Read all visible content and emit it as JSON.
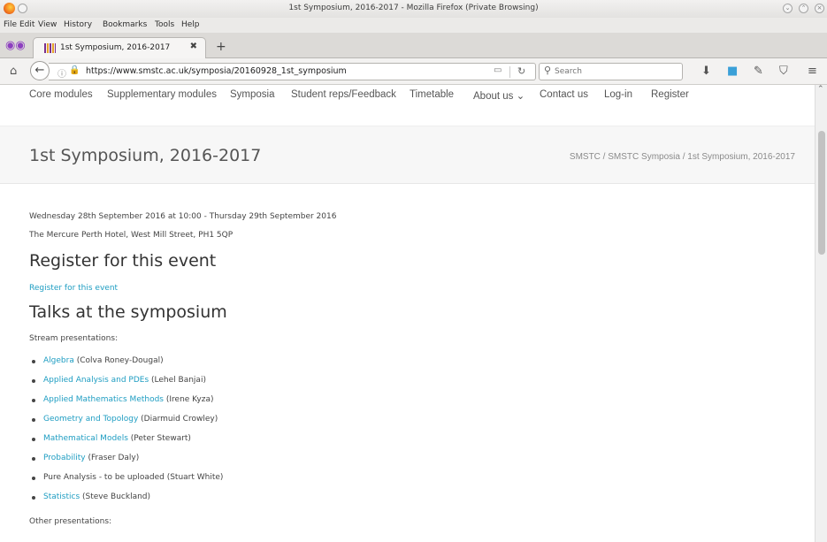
{
  "window": {
    "title": "1st Symposium, 2016-2017 - Mozilla Firefox (Private Browsing)"
  },
  "menu": [
    "File",
    "Edit",
    "View",
    "History",
    "Bookmarks",
    "Tools",
    "Help"
  ],
  "tab": {
    "label": "1st Symposium, 2016-2017",
    "close": "✖",
    "new_tab": "+"
  },
  "address": {
    "url": "https://www.smstc.ac.uk/symposia/20160928_1st_symposium",
    "search_placeholder": "Search"
  },
  "site_nav": [
    "Core modules",
    "Supplementary modules",
    "Symposia",
    "Student reps/Feedback",
    "Timetable",
    "About us ⌄",
    "Contact us",
    "Log-in",
    "Register"
  ],
  "page": {
    "title": "1st Symposium, 2016-2017",
    "breadcrumb": "SMSTC / SMSTC Symposia / 1st Symposium, 2016-2017",
    "date_line": "Wednesday 28th September 2016 at 10:00 - Thursday 29th September 2016",
    "venue_line": "The Mercure Perth Hotel, West Mill Street, PH1 5QP",
    "register_heading": "Register for this event",
    "register_link": "Register for this event",
    "talks_heading": "Talks at the symposium",
    "stream_label": "Stream presentations:",
    "other_label": "Other presentations:",
    "stream_presentations": [
      {
        "link": "Algebra",
        "speaker": " (Colva Roney-Dougal)"
      },
      {
        "link": "Applied Analysis and PDEs",
        "speaker": " (Lehel Banjai)"
      },
      {
        "link": "Applied Mathematics Methods",
        "speaker": " (Irene Kyza)"
      },
      {
        "link": "Geometry and Topology",
        "speaker": " (Diarmuid Crowley)"
      },
      {
        "link": "Mathematical Models",
        "speaker": " (Peter Stewart)"
      },
      {
        "link": "Probability",
        "speaker": " (Fraser Daly)"
      },
      {
        "link": "",
        "speaker": "Pure Analysis - to be uploaded (Stuart White)"
      },
      {
        "link": "Statistics",
        "speaker": " (Steve Buckland)"
      }
    ]
  },
  "colors": {
    "link": "#1e9dc2",
    "banner_bg": "#f7f7f7",
    "text": "#333333"
  }
}
